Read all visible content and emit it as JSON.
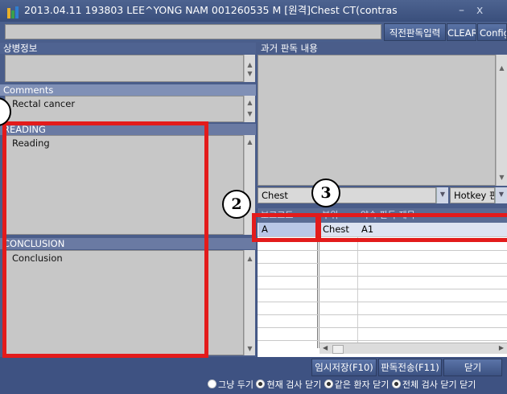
{
  "window": {
    "title": "2013.04.11 193803 LEE^YONG NAM 001260535  M [원격]Chest CT(contras",
    "min_glyph": "–",
    "close_glyph": "x"
  },
  "toolbar": {
    "prev_reading_input_label": "직전판독입력",
    "clear_label": "CLEAR",
    "config_label": "Config"
  },
  "left": {
    "clinical_info_label": "상병정보",
    "comments_label": "Comments",
    "comments_text": "Rectal cancer",
    "reading_label": "READING",
    "reading_text": "Reading",
    "conclusion_label": "CONCLUSION",
    "conclusion_text": "Conclusion"
  },
  "right": {
    "past_reading_label": "과거 판독 내용",
    "category_value": "Chest",
    "hotkey_label": "Hotkey 판",
    "grid_headers": [
      "보고코드",
      "부위",
      "약속 판독 제목"
    ],
    "grid_rows": [
      {
        "code": "A",
        "part": "Chest",
        "title": "A1"
      }
    ]
  },
  "annotations": {
    "circle_2": "2",
    "circle_3": "3",
    "accent_color": "#e31b1b"
  },
  "bottom": {
    "temp_save_label": "임시저장(F10)",
    "send_label": "판독전송(F11)",
    "close_label": "닫기",
    "close2_label": "닫기",
    "radio_options": [
      "그냥 두기",
      "현재 검사 닫기",
      "같은 환자 닫기",
      "전체 검사 닫기"
    ],
    "radio_selected": 1
  }
}
